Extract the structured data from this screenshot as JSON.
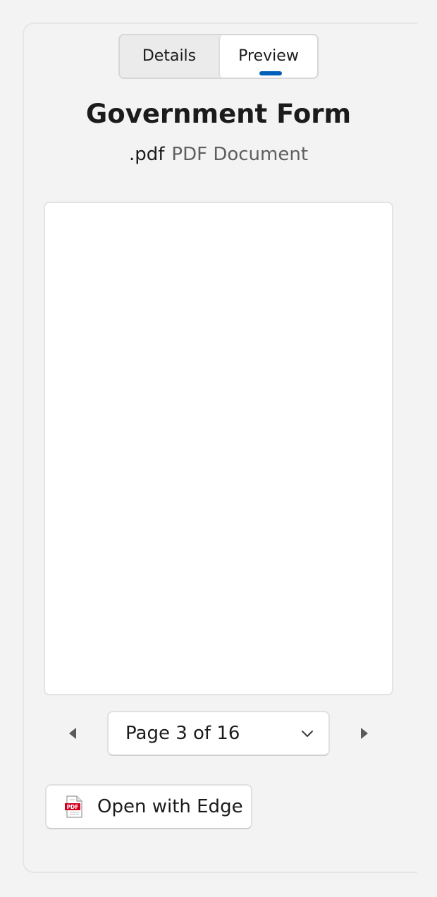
{
  "tabs": {
    "details_label": "Details",
    "preview_label": "Preview",
    "selected": "Preview"
  },
  "file": {
    "name": "Government Form",
    "extension": ".pdf",
    "type": "PDF Document"
  },
  "pager": {
    "current_label": "Page 3 of 16",
    "current_page": 3,
    "total_pages": 16
  },
  "actions": {
    "open_with_label": "Open with Edge",
    "open_with_icon": "pdf-file-icon",
    "pdf_icon_text": "PDF"
  },
  "colors": {
    "accent": "#005fb8",
    "pdf_red": "#d1001f"
  }
}
